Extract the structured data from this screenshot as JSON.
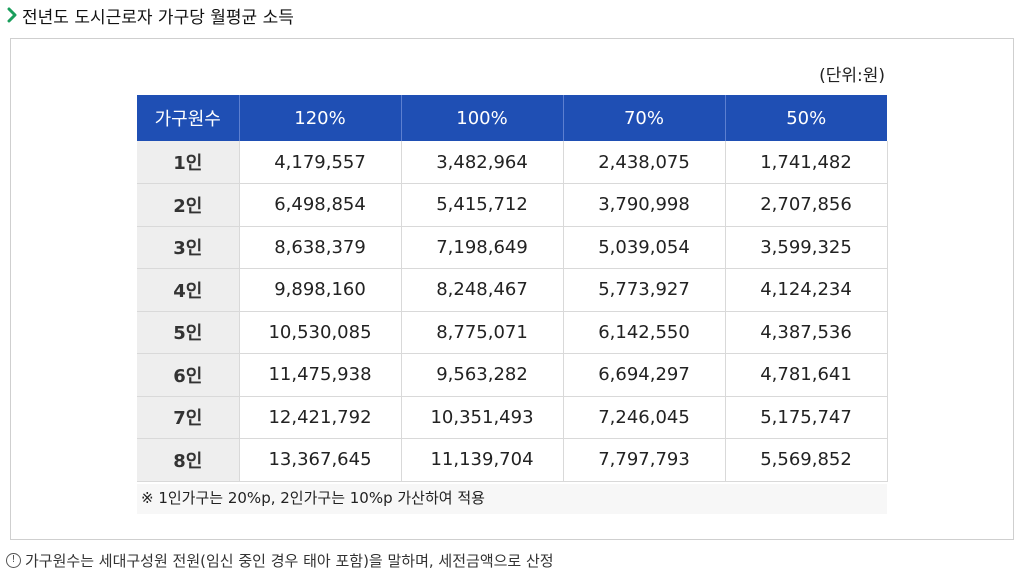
{
  "title": "전년도 도시근로자 가구당 월평균 소득",
  "unit": "(단위:원)",
  "table": {
    "headers": [
      "가구원수",
      "120%",
      "100%",
      "70%",
      "50%"
    ],
    "rows": [
      [
        "1인",
        "4,179,557",
        "3,482,964",
        "2,438,075",
        "1,741,482"
      ],
      [
        "2인",
        "6,498,854",
        "5,415,712",
        "3,790,998",
        "2,707,856"
      ],
      [
        "3인",
        "8,638,379",
        "7,198,649",
        "5,039,054",
        "3,599,325"
      ],
      [
        "4인",
        "9,898,160",
        "8,248,467",
        "5,773,927",
        "4,124,234"
      ],
      [
        "5인",
        "10,530,085",
        "8,775,071",
        "6,142,550",
        "4,387,536"
      ],
      [
        "6인",
        "11,475,938",
        "9,563,282",
        "6,694,297",
        "4,781,641"
      ],
      [
        "7인",
        "12,421,792",
        "10,351,493",
        "7,246,045",
        "5,175,747"
      ],
      [
        "8인",
        "13,367,645",
        "11,139,704",
        "7,797,793",
        "5,569,852"
      ]
    ]
  },
  "note": "※ 1인가구는 20%p, 2인가구는 10%p 가산하여 적용",
  "footer": {
    "icon_glyph": "!",
    "text": "가구원수는 세대구성원 전원(임신 중인 경우 태아 포함)을 말하며, 세전금액으로 산정"
  },
  "colors": {
    "header_bg": "#1f4fb4",
    "row_head_bg": "#eeeeee",
    "accent_chevron": "#1a9e5c"
  },
  "icons": {
    "title_marker": "chevron-right-icon",
    "footer_marker": "info-icon"
  }
}
